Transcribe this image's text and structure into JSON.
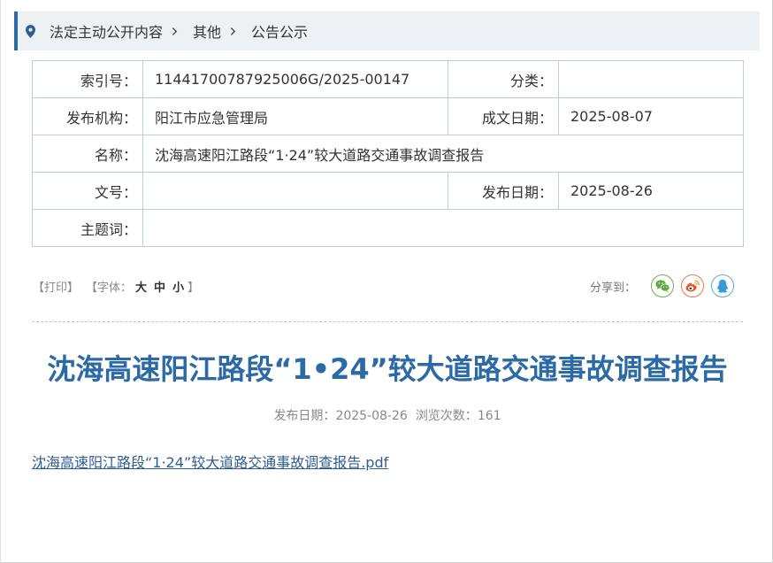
{
  "breadcrumb": {
    "icon": "location-pin-icon",
    "separator_icon": "chevron-right-icon",
    "items": [
      "法定主动公开内容",
      "其他",
      "公告公示"
    ]
  },
  "info_table": {
    "index_no": {
      "label": "索引号：",
      "value": "11441700787925006G/2025-00147"
    },
    "category": {
      "label": "分类：",
      "value": ""
    },
    "publisher": {
      "label": "发布机构：",
      "value": "阳江市应急管理局"
    },
    "written_date": {
      "label": "成文日期：",
      "value": "2025-08-07"
    },
    "name": {
      "label": "名称：",
      "value": "沈海高速阳江路段“1·24”较大道路交通事故调查报告"
    },
    "doc_no": {
      "label": "文号：",
      "value": ""
    },
    "publish_date": {
      "label": "发布日期：",
      "value": "2025-08-26"
    },
    "keywords": {
      "label": "主题词：",
      "value": ""
    }
  },
  "tools": {
    "print_label": "【打印】",
    "font_size": {
      "prefix": "【字体：",
      "large": "大",
      "medium": "中",
      "small": "小",
      "suffix": "】"
    },
    "share": {
      "label": "分享到：",
      "buttons": [
        {
          "icon": "wechat-icon",
          "color": "#5aa93a"
        },
        {
          "icon": "weibo-icon",
          "color": "#e6522c"
        },
        {
          "icon": "qq-icon",
          "color": "#3a9ad9"
        }
      ]
    }
  },
  "article": {
    "title": "沈海高速阳江路段“1•24”较大道路交通事故调查报告",
    "meta": {
      "publish_date_label": "发布日期：",
      "publish_date": "2025-08-26",
      "views_label": "浏览次数：",
      "views": "161"
    },
    "attachment_link": "沈海高速阳江路段“1·24”较大道路交通事故调查报告.pdf"
  },
  "colors": {
    "accent": "#2d6aa5",
    "breadcrumb_bg": "#eef1f4",
    "table_border": "#b7d0e2",
    "title": "#2c6aa6",
    "link": "#2e5e92"
  }
}
